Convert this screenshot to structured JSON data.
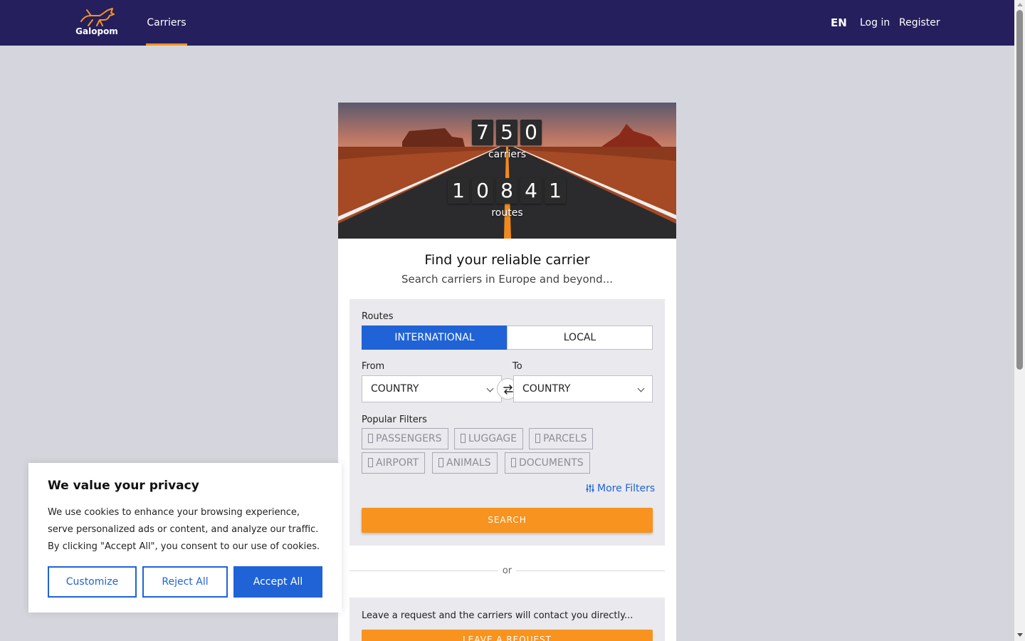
{
  "header": {
    "logo_text": "Galopom",
    "nav_carriers": "Carriers",
    "lang": "EN",
    "login": "Log in",
    "register": "Register"
  },
  "hero": {
    "carriers_digits": [
      "7",
      "5",
      "0"
    ],
    "carriers_label": "carriers",
    "routes_digits": [
      "1",
      "0",
      "8",
      "4",
      "1"
    ],
    "routes_label": "routes"
  },
  "search": {
    "title": "Find your reliable carrier",
    "subtitle": "Search carriers in Europe and beyond...",
    "routes_label": "Routes",
    "tab_international": "INTERNATIONAL",
    "tab_local": "LOCAL",
    "from_label": "From",
    "to_label": "To",
    "from_value": "COUNTRY",
    "to_value": "COUNTRY",
    "popular_filters_label": "Popular Filters",
    "filters": [
      "PASSENGERS",
      "LUGGAGE",
      "PARCELS",
      "AIRPORT",
      "ANIMALS",
      "DOCUMENTS"
    ],
    "more_filters": "More Filters",
    "search_button": "SEARCH"
  },
  "divider": {
    "or": "or"
  },
  "request": {
    "text": "Leave a request and the carriers will contact you directly...",
    "button": "LEAVE A REQUEST"
  },
  "cookie": {
    "title": "We value your privacy",
    "body": "We use cookies to enhance your browsing experience, serve personalized ads or content, and analyze our traffic. By clicking \"Accept All\", you consent to our use of cookies.",
    "customize": "Customize",
    "reject": "Reject All",
    "accept": "Accept All"
  },
  "colors": {
    "header_bg": "#251f5e",
    "accent_orange": "#f7931e",
    "primary_blue": "#1f63d6"
  }
}
